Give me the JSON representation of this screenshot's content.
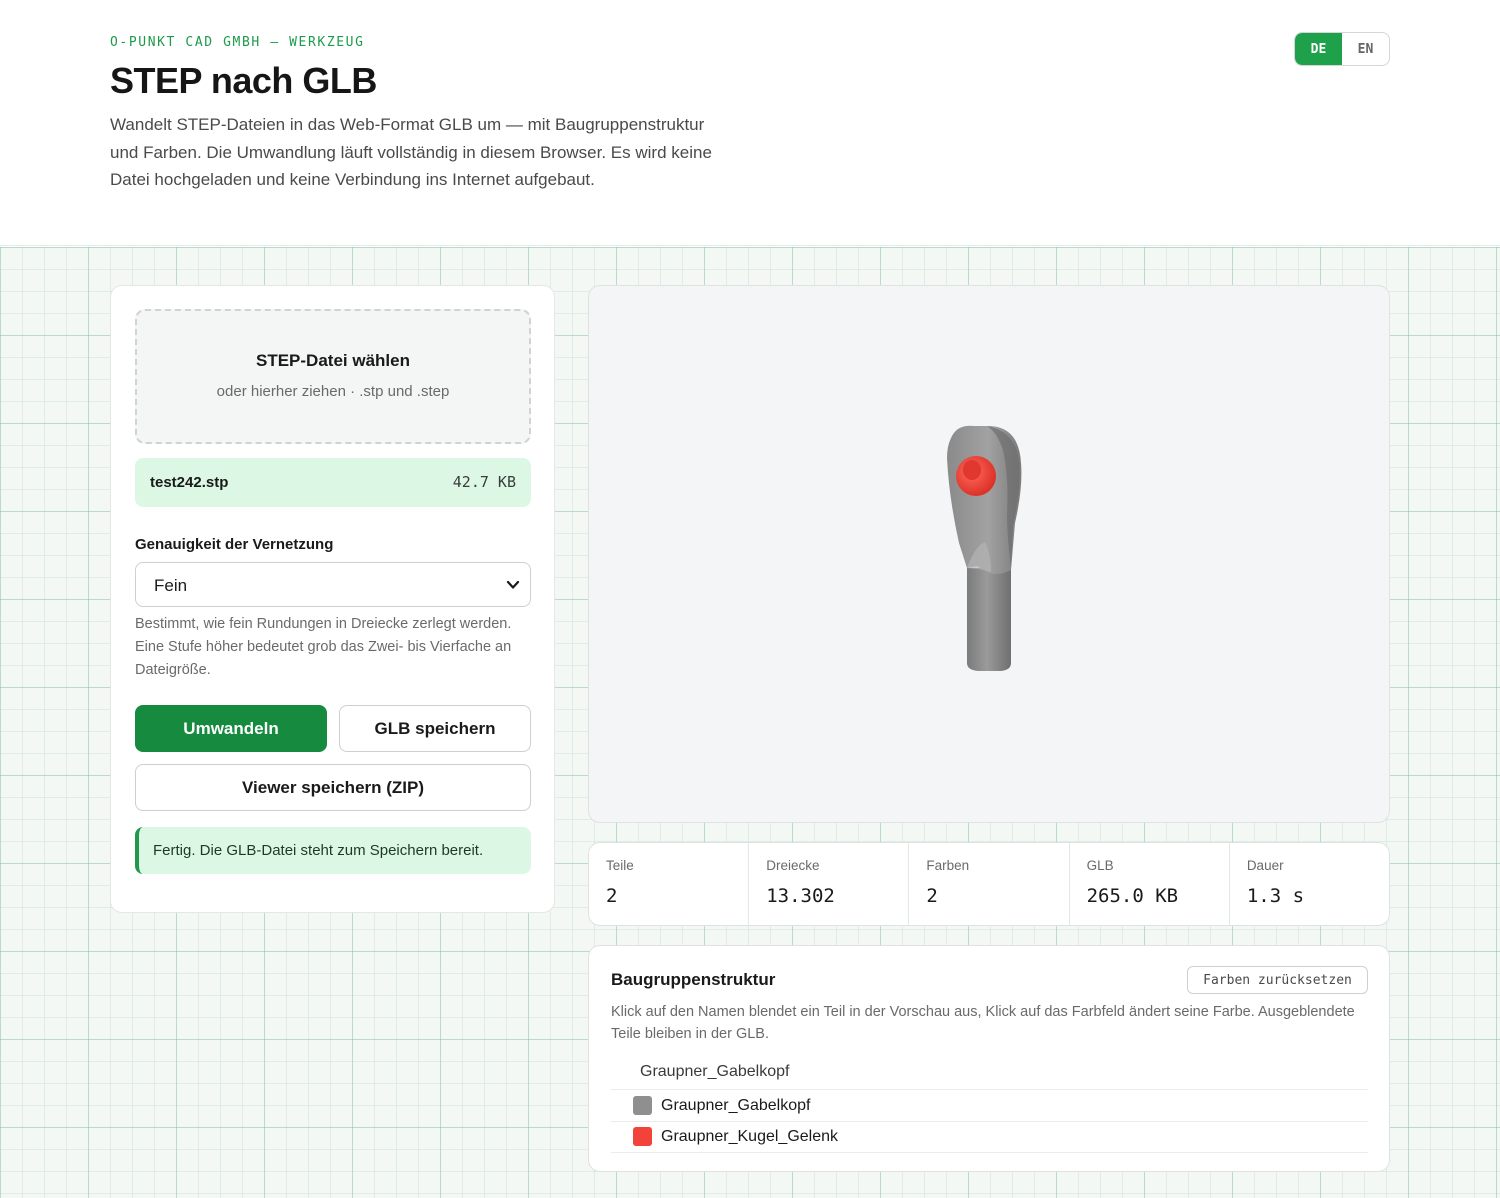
{
  "header": {
    "eyebrow": "O-PUNKT CAD GMBH — WERKZEUG",
    "title": "STEP nach GLB",
    "intro": "Wandelt STEP-Dateien in das Web-Format GLB um — mit Baugruppenstruktur und Farben. Die Umwandlung läuft vollständig in diesem Browser. Es wird keine Datei hochgeladen und keine Verbindung ins Internet aufgebaut."
  },
  "language": {
    "options": [
      "DE",
      "EN"
    ],
    "active": "DE"
  },
  "dropzone": {
    "title": "STEP-Datei wählen",
    "subtitle": "oder hierher ziehen · .stp und .step"
  },
  "file": {
    "name": "test242.stp",
    "size": "42.7 KB"
  },
  "mesh": {
    "label": "Genauigkeit der Vernetzung",
    "selected": "Fein",
    "hint": "Bestimmt, wie fein Rundungen in Dreiecke zerlegt werden. Eine Stufe höher bedeutet grob das Zwei- bis Vierfache an Dateigröße."
  },
  "actions": {
    "convert": "Umwandeln",
    "save_glb": "GLB speichern",
    "save_viewer": "Viewer speichern (ZIP)"
  },
  "status": "Fertig. Die GLB-Datei steht zum Speichern bereit.",
  "stats": [
    {
      "label": "Teile",
      "value": "2"
    },
    {
      "label": "Dreiecke",
      "value": "13.302"
    },
    {
      "label": "Farben",
      "value": "2"
    },
    {
      "label": "GLB",
      "value": "265.0 KB"
    },
    {
      "label": "Dauer",
      "value": "1.3 s"
    }
  ],
  "tree": {
    "title": "Baugruppenstruktur",
    "reset_label": "Farben zurücksetzen",
    "description": "Klick auf den Namen blendet ein Teil in der Vorschau aus, Klick auf das Farbfeld ändert seine Farbe. Ausgeblendete Teile bleiben in der GLB.",
    "root": "Graupner_Gabelkopf",
    "parts": [
      {
        "name": "Graupner_Gabelkopf",
        "color": "#8f8f8f"
      },
      {
        "name": "Graupner_Kugel_Gelenk",
        "color": "#f2423a"
      }
    ]
  },
  "colors": {
    "accent": "#1fa04b",
    "primary_button": "#168a3f",
    "success_bg": "#dcf8e4"
  }
}
